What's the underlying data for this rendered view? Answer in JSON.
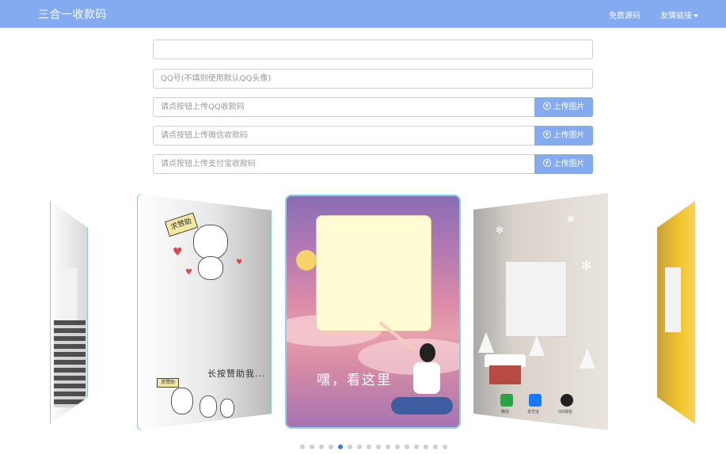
{
  "navbar": {
    "brand": "三合一收款码",
    "links": [
      "免费源码",
      "友情链接"
    ],
    "bg_color": "#84aaf0"
  },
  "form": {
    "name_field": {
      "value": "",
      "placeholder": ""
    },
    "qq_field": {
      "placeholder": "QQ号(不填则使用默认QQ头像)"
    },
    "qq_code_field": {
      "placeholder": "请点按钮上传QQ收款码"
    },
    "wechat_code_field": {
      "placeholder": "请点按钮上传微信收款码"
    },
    "alipay_code_field": {
      "placeholder": "请点按钮上传支付宝收款码"
    },
    "upload_label": "上传图片",
    "upload_icon": "upload-circle-icon"
  },
  "carousel": {
    "left_card": {
      "sign": "求赞助",
      "caption": "长按赞助我...",
      "small_sign": "求赞助"
    },
    "center_card": {
      "caption": "嘿，看这里"
    },
    "right_card": {
      "labels": [
        "微信",
        "支付宝",
        "QQ钱包"
      ]
    },
    "slide_count": 16,
    "active_index": 4,
    "active_color": "#3a78d8"
  }
}
